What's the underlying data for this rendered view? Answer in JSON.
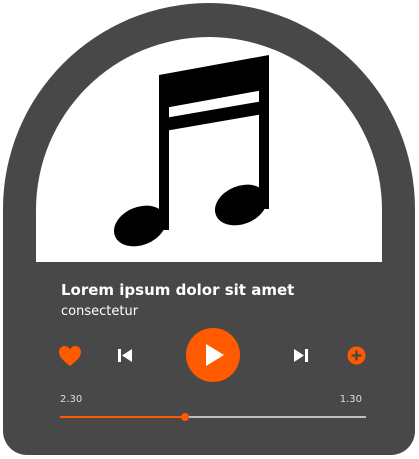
{
  "colors": {
    "panel": "#484848",
    "accent": "#ff5a00",
    "artwork_bg": "#ffffff",
    "text": "#ffffff",
    "track": "#bfbfbf"
  },
  "artwork": {
    "icon": "beamed-sixteenth-notes-icon"
  },
  "track": {
    "title": "Lorem ipsum dolor sit amet",
    "artist": "consectetur"
  },
  "controls": {
    "like_icon": "heart-icon",
    "previous_icon": "skip-previous-icon",
    "play_icon": "play-icon",
    "next_icon": "skip-next-icon",
    "add_icon": "plus-circle-icon"
  },
  "progress": {
    "elapsed": "2.30",
    "remaining": "1.30",
    "fraction": 0.41
  }
}
